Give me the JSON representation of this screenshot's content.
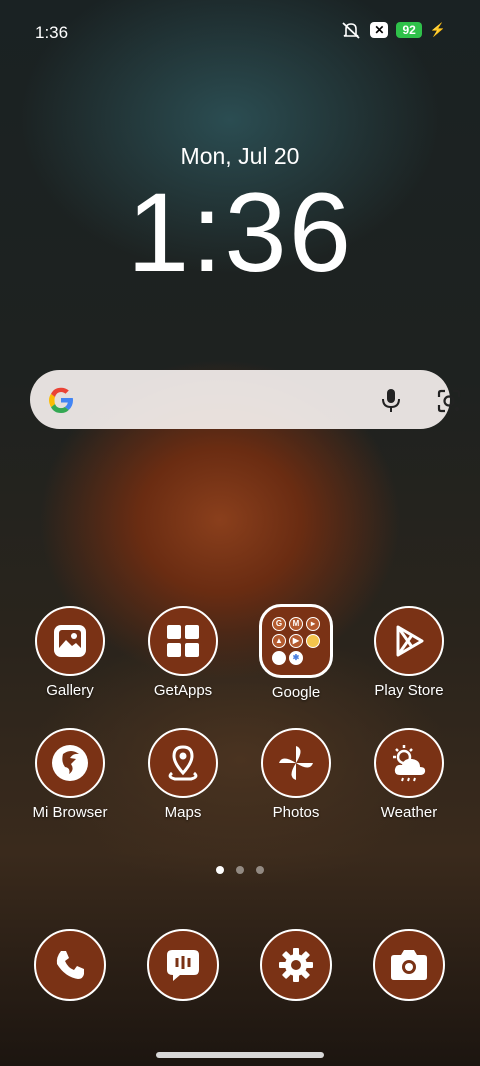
{
  "status": {
    "time": "1:36",
    "battery": "92",
    "icons": [
      "mute-icon",
      "x-icon",
      "battery-icon",
      "charging-bolt-icon"
    ]
  },
  "lockscreen": {
    "date": "Mon, Jul 20",
    "clock": "1:36"
  },
  "search": {
    "icons": [
      "google-g-icon",
      "microphone-icon",
      "lens-icon"
    ]
  },
  "apps_row1": [
    {
      "label": "Gallery",
      "icon": "gallery-icon"
    },
    {
      "label": "GetApps",
      "icon": "getapps-icon"
    },
    {
      "label": "Google",
      "icon": "google-folder-icon"
    },
    {
      "label": "Play Store",
      "icon": "play-store-icon"
    }
  ],
  "apps_row2": [
    {
      "label": "Mi Browser",
      "icon": "browser-icon"
    },
    {
      "label": "Maps",
      "icon": "maps-icon"
    },
    {
      "label": "Photos",
      "icon": "photos-icon"
    },
    {
      "label": "Weather",
      "icon": "weather-icon"
    }
  ],
  "page_indicator": {
    "pages": 3,
    "active": 1
  },
  "dock": [
    {
      "icon": "phone-icon"
    },
    {
      "icon": "messages-icon"
    },
    {
      "icon": "settings-icon"
    },
    {
      "icon": "camera-icon"
    }
  ],
  "colors": {
    "app_background": "#7a3215",
    "battery": "#2fc14a"
  }
}
